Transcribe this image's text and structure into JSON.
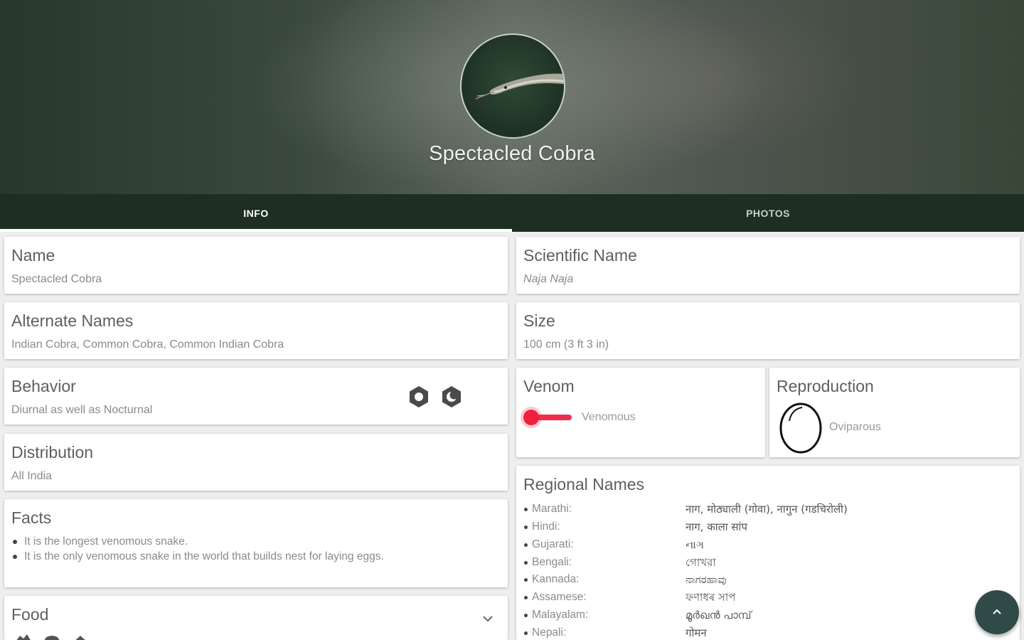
{
  "header": {
    "title": "Spectacled Cobra"
  },
  "tabs": [
    {
      "label": "INFO",
      "active": true
    },
    {
      "label": "PHOTOS",
      "active": false
    }
  ],
  "cards": {
    "name": {
      "title": "Name",
      "value": "Spectacled Cobra"
    },
    "alternate_names": {
      "title": "Alternate Names",
      "value": "Indian Cobra, Common Cobra, Common Indian Cobra"
    },
    "behavior": {
      "title": "Behavior",
      "value": "Diurnal as well as Nocturnal",
      "icons": [
        "sun-icon",
        "moon-icon"
      ]
    },
    "distribution": {
      "title": "Distribution",
      "value": "All India"
    },
    "facts": {
      "title": "Facts",
      "items": [
        "It is the longest venomous snake.",
        "It is the only venomous snake in the world that builds nest for laying eggs."
      ]
    },
    "food": {
      "title": "Food",
      "icons": [
        "bird-icon",
        "rodent-icon",
        "frog-icon"
      ]
    },
    "scientific_name": {
      "title": "Scientific Name",
      "value": "Naja Naja"
    },
    "size": {
      "title": "Size",
      "value": "100 cm (3 ft 3 in)"
    },
    "venom": {
      "title": "Venom",
      "value": "Venomous",
      "toggle_on": true
    },
    "reproduction": {
      "title": "Reproduction",
      "value": "Oviparous"
    },
    "regional_names": {
      "title": "Regional Names",
      "items": [
        {
          "lang": "Marathi:",
          "name": "नाग, मोठ्याली (गोवा), नागुन (गडचिरोली)"
        },
        {
          "lang": "Hindi:",
          "name": "नाग, काला सांप"
        },
        {
          "lang": "Gujarati:",
          "name": "નાગ"
        },
        {
          "lang": "Bengali:",
          "name": "গোখরা"
        },
        {
          "lang": "Kannada:",
          "name": "ನಾಗರಹಾವು"
        },
        {
          "lang": "Assamese:",
          "name": "ফণাধৰ সাপ"
        },
        {
          "lang": "Malayalam:",
          "name": "മൂർഖൻ പാമ്പ്"
        },
        {
          "lang": "Nepali:",
          "name": "गोमन"
        }
      ]
    }
  },
  "colors": {
    "primary": "#1e2f21",
    "accent": "#ef2d4b",
    "fab": "#2f4a47"
  }
}
